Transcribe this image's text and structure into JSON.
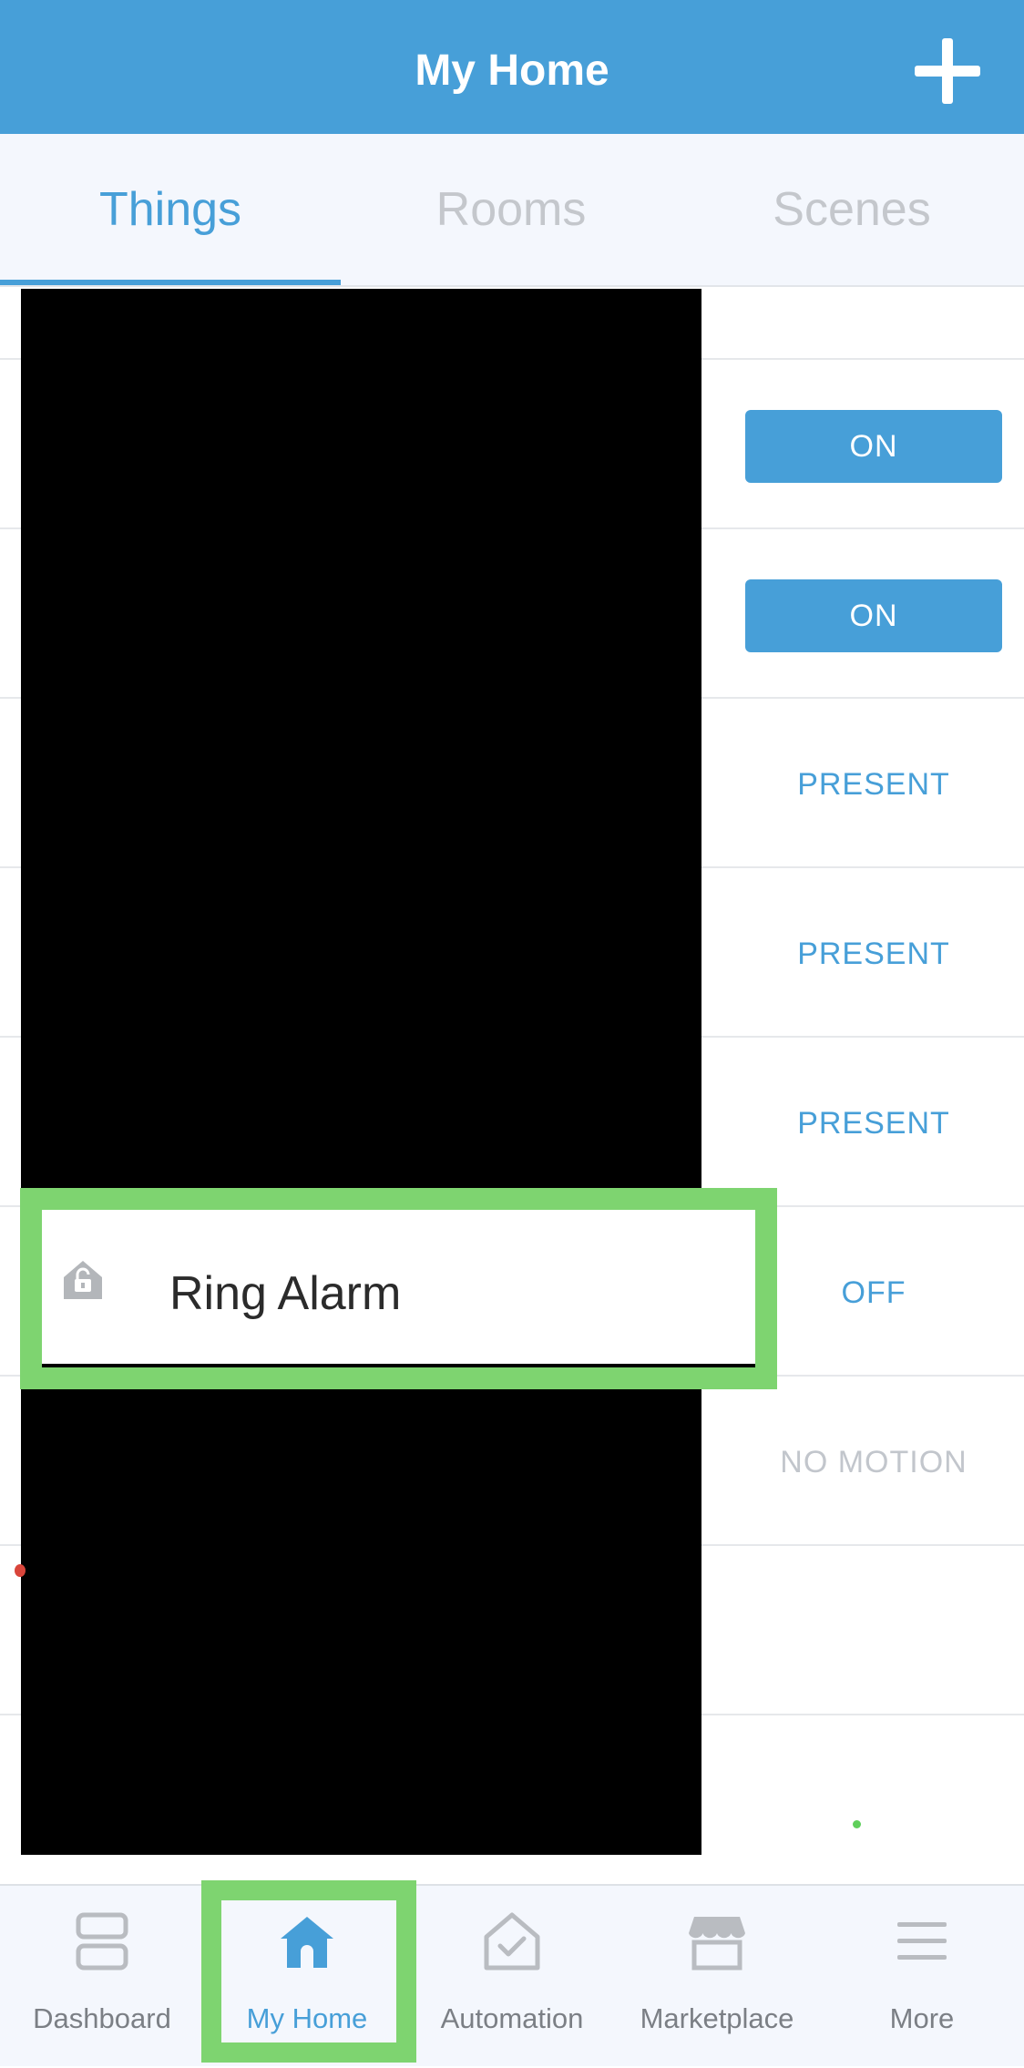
{
  "header": {
    "title": "My Home"
  },
  "tabs": [
    {
      "label": "Things",
      "active": true
    },
    {
      "label": "Rooms",
      "active": false
    },
    {
      "label": "Scenes",
      "active": false
    }
  ],
  "rows": [
    {
      "status": "ON",
      "style": "button"
    },
    {
      "status": "ON",
      "style": "button"
    },
    {
      "status": "PRESENT",
      "style": "text"
    },
    {
      "status": "PRESENT",
      "style": "text"
    },
    {
      "status": "PRESENT",
      "style": "text"
    },
    {
      "status": "OFF",
      "style": "text",
      "name": "Ring Alarm",
      "icon": "home-lock-icon"
    },
    {
      "status": "NO MOTION",
      "style": "muted"
    }
  ],
  "bottom_nav": [
    {
      "label": "Dashboard",
      "icon": "dashboard-icon",
      "active": false
    },
    {
      "label": "My Home",
      "icon": "home-icon",
      "active": true
    },
    {
      "label": "Automation",
      "icon": "automation-icon",
      "active": false
    },
    {
      "label": "Marketplace",
      "icon": "marketplace-icon",
      "active": false
    },
    {
      "label": "More",
      "icon": "menu-icon",
      "active": false
    }
  ],
  "colors": {
    "accent": "#479fd8",
    "highlight": "#7ed470",
    "muted": "#c2c6cc"
  }
}
